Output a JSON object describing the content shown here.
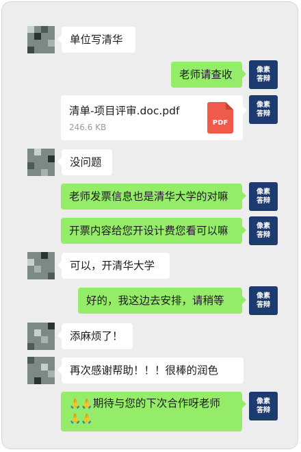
{
  "badge": {
    "line1": "像素",
    "line2": "答辩"
  },
  "messages": [
    {
      "side": "left",
      "text": "单位写清华"
    },
    {
      "side": "right",
      "text": "老师请查收"
    },
    {
      "side": "right",
      "type": "file",
      "file_name": "清单-项目评审.doc.pdf",
      "file_size": "246.6 KB",
      "file_icon": "pdf-icon",
      "file_icon_label": "PDF"
    },
    {
      "side": "left",
      "text": "没问题"
    },
    {
      "side": "right",
      "text": "老师发票信息也是清华大学的对嘛"
    },
    {
      "side": "right",
      "text": "开票内容给您开设计费您看可以嘛"
    },
    {
      "side": "left",
      "text": "可以，开清华大学"
    },
    {
      "side": "right",
      "text": "好的，我这边去安排，请稍等"
    },
    {
      "side": "left",
      "text": "添麻烦了！"
    },
    {
      "side": "left",
      "text": "再次感谢帮助！！！很棒的润色"
    },
    {
      "side": "right",
      "line1_prefix": "🙏🙏",
      "line1_text": "期待与您的下次合作呀老师",
      "line2": "🙏🙏",
      "emoji_icon": "bow-emoji-icon"
    }
  ],
  "colors": {
    "bubble_green": "#95ec69",
    "bubble_white": "#ffffff",
    "badge": "#1d3b6e",
    "pdf": "#f05a4a",
    "background": "#ededed"
  }
}
